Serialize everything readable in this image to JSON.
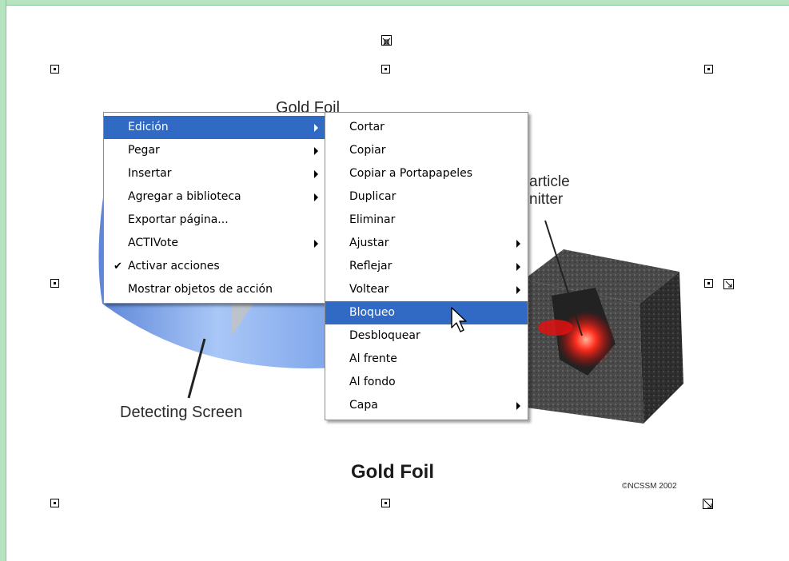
{
  "colors": {
    "frame": "#b7e4c0",
    "menu_highlight": "#316ac5",
    "cylinder": "#7aa6ee",
    "glow": "#ff2a1a"
  },
  "slide": {
    "title_top": "Gold Foil",
    "particle_label": "Particle\nEmitter",
    "particle_label_visible": "article\nnitter",
    "detecting_label": "Detecting Screen",
    "gold_foil_label": "Gold Foil",
    "copyright": "©NCSSM 2002"
  },
  "context_menu": {
    "items": [
      {
        "label": "Edición",
        "submenu": true,
        "selected": true
      },
      {
        "label": "Pegar",
        "submenu": true
      },
      {
        "label": "Insertar",
        "submenu": true
      },
      {
        "label": "Agregar a biblioteca",
        "submenu": true
      },
      {
        "label": "Exportar página...",
        "submenu": false
      },
      {
        "label": "ACTIVote",
        "submenu": true
      },
      {
        "label": "Activar acciones",
        "submenu": false,
        "checked": true
      },
      {
        "label": "Mostrar objetos de acción",
        "submenu": false
      }
    ],
    "check_glyph": "✔"
  },
  "submenu": {
    "items": [
      {
        "label": "Cortar"
      },
      {
        "label": "Copiar"
      },
      {
        "label": "Copiar a Portapapeles"
      },
      {
        "label": "Duplicar"
      },
      {
        "label": "Eliminar"
      },
      {
        "label": "Ajustar",
        "submenu": true
      },
      {
        "label": "Reflejar",
        "submenu": true
      },
      {
        "label": "Voltear",
        "submenu": true
      },
      {
        "label": "Bloqueo",
        "selected": true
      },
      {
        "label": "Desbloquear"
      },
      {
        "label": "Al frente"
      },
      {
        "label": "Al fondo"
      },
      {
        "label": "Capa",
        "submenu": true
      }
    ]
  }
}
